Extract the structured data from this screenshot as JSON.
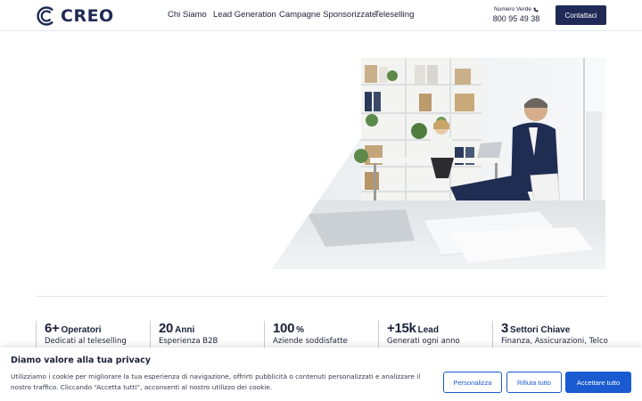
{
  "header": {
    "logo_text": "CREO",
    "nav": [
      "Chi Siamo",
      "Lead Generation",
      "Campagne Sponsorizzate",
      "Teleselling"
    ],
    "phone_label": "Numero Verde",
    "phone_number": "800 95 49 38",
    "contact_label": "Contattaci"
  },
  "stats": [
    {
      "value": "6+",
      "unit": "Operatori",
      "desc": "Dedicati al teleselling"
    },
    {
      "value": "20",
      "unit": "Anni",
      "desc": "Esperienza B2B"
    },
    {
      "value": "100",
      "unit": "%",
      "desc": "Aziende soddisfatte"
    },
    {
      "value": "+15k",
      "unit": "Lead",
      "desc": "Generati ogni anno"
    },
    {
      "value": "3",
      "unit": "Settori Chiave",
      "desc": "Finanza, Assicurazioni, Telco"
    }
  ],
  "cookie": {
    "title": "Diamo valore alla tua privacy",
    "text": "Utilizziamo i cookie per migliorare la tua esperienza di navigazione, offrirti pubblicità o contenuti personalizzati e analizzare il nostro traffico. Cliccando “Accetta tutti”, acconsenti al nostro utilizzo dei cookie.",
    "btn_customize": "Personalizza",
    "btn_reject": "Rifiuta tutto",
    "btn_accept": "Accettare tutto"
  },
  "colors": {
    "brand_navy": "#1f2a56",
    "cookie_blue": "#1a5bd1"
  },
  "icons": [
    "logo-c-icon",
    "phone-icon"
  ]
}
